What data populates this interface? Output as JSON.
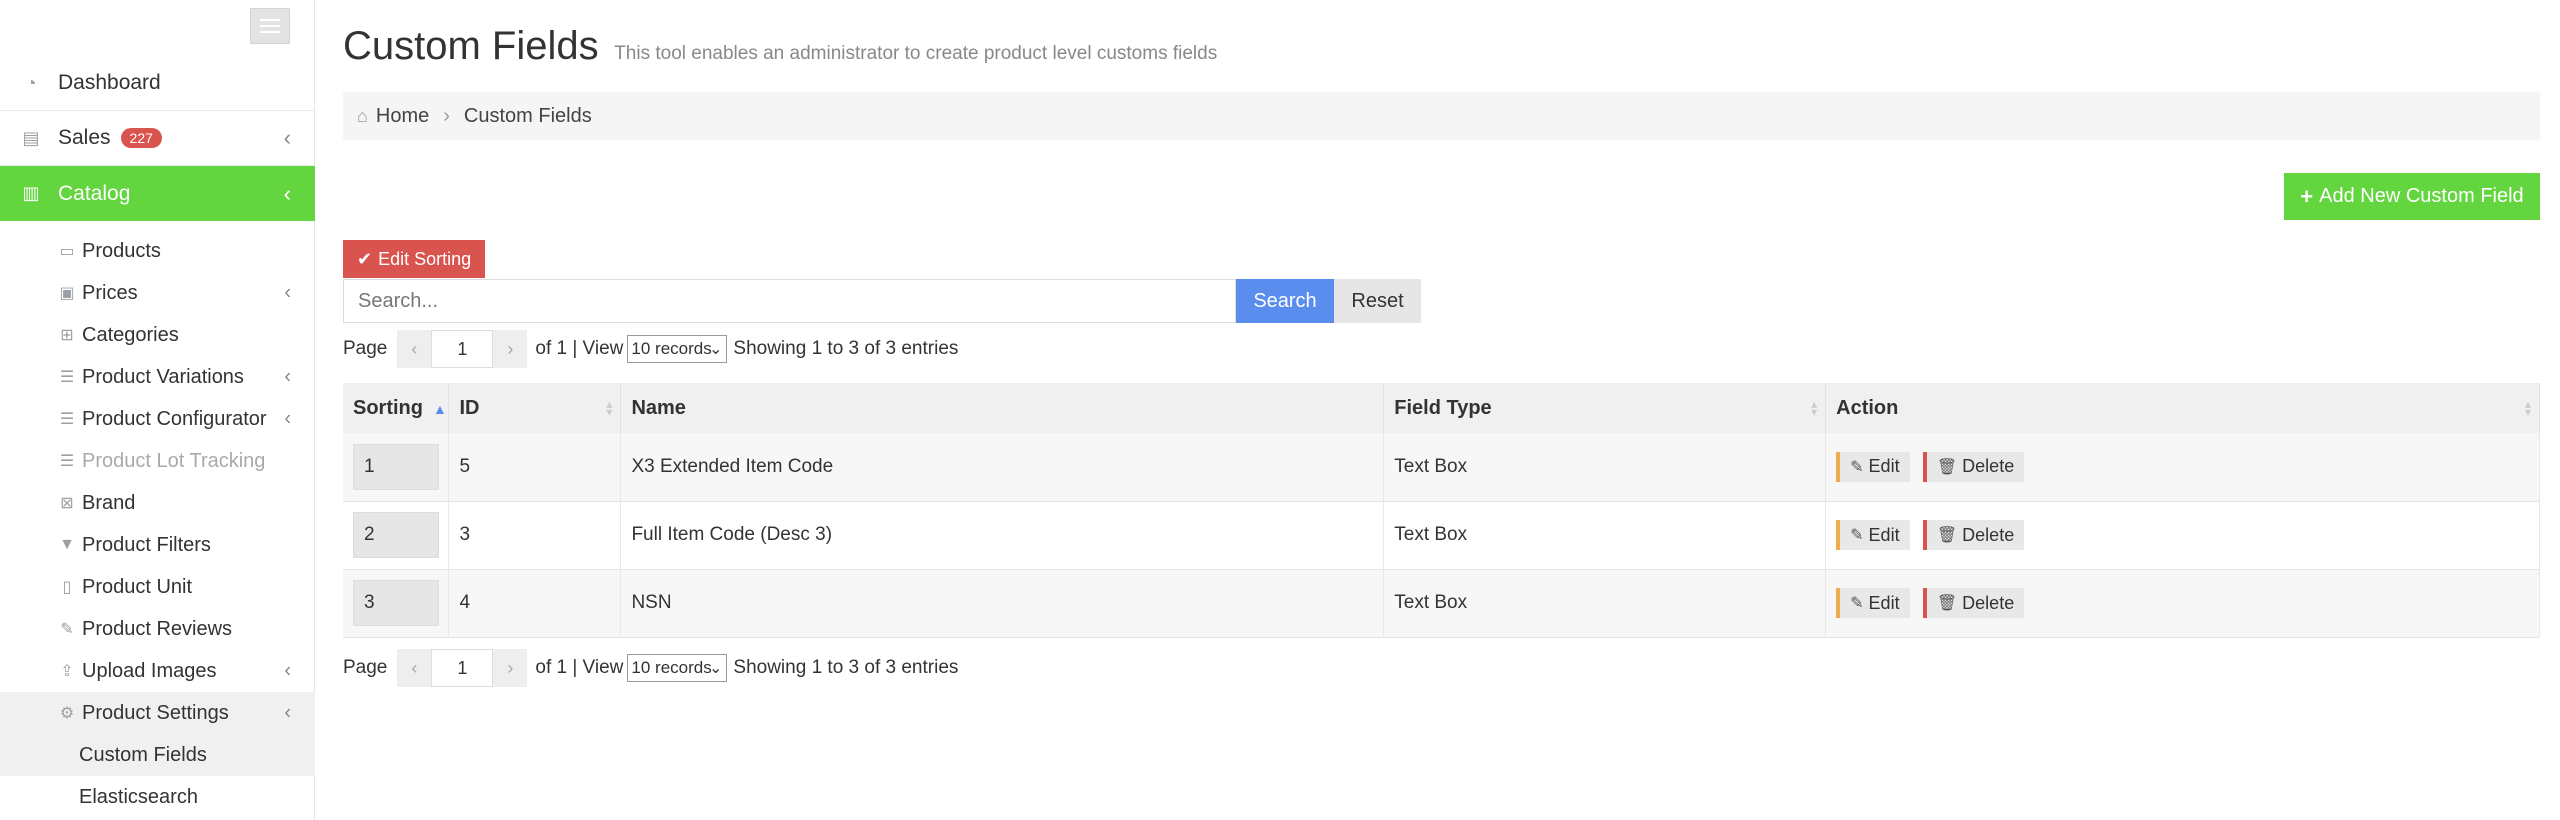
{
  "sidebar": {
    "top_items": [
      {
        "label": "Dashboard",
        "icon": "dashboard-icon"
      },
      {
        "label": "Sales",
        "badge": "227",
        "icon": "sales-icon"
      },
      {
        "label": "Catalog",
        "icon": "catalog-icon"
      }
    ],
    "catalog_items": [
      {
        "label": "Products"
      },
      {
        "label": "Prices"
      },
      {
        "label": "Categories"
      },
      {
        "label": "Product Variations"
      },
      {
        "label": "Product Configurator"
      },
      {
        "label": "Product Lot Tracking"
      },
      {
        "label": "Brand"
      },
      {
        "label": "Product Filters"
      },
      {
        "label": "Product Unit"
      },
      {
        "label": "Product Reviews"
      },
      {
        "label": "Upload Images"
      },
      {
        "label": "Product Settings"
      }
    ],
    "settings_items": [
      {
        "label": "Custom Fields"
      },
      {
        "label": "Elasticsearch"
      }
    ]
  },
  "header": {
    "title": "Custom Fields",
    "subtitle": "This tool enables an administrator to create product level customs fields"
  },
  "breadcrumb": {
    "home": "Home",
    "current": "Custom Fields"
  },
  "toolbar": {
    "add_label": "Add New Custom Field",
    "edit_sorting_label": "Edit Sorting",
    "search_placeholder": "Search...",
    "search_label": "Search",
    "reset_label": "Reset"
  },
  "pager": {
    "page_label": "Page",
    "page_value": "1",
    "of_label": "of 1 | View",
    "view_value": "10 records",
    "showing": "Showing 1 to 3 of 3 entries"
  },
  "table": {
    "headers": [
      "Sorting",
      "ID",
      "Name",
      "Field Type",
      "Action"
    ],
    "rows": [
      {
        "sorting": "1",
        "id": "5",
        "name": "X3 Extended Item Code",
        "type": "Text Box"
      },
      {
        "sorting": "2",
        "id": "3",
        "name": "Full Item Code (Desc 3)",
        "type": "Text Box"
      },
      {
        "sorting": "3",
        "id": "4",
        "name": "NSN",
        "type": "Text Box"
      }
    ],
    "edit_label": "Edit",
    "delete_label": "Delete"
  },
  "colors": {
    "accent_green": "#62d53f",
    "danger_red": "#d9534f",
    "primary_blue": "#5a8dee",
    "warning_orange": "#f0ad4e"
  }
}
